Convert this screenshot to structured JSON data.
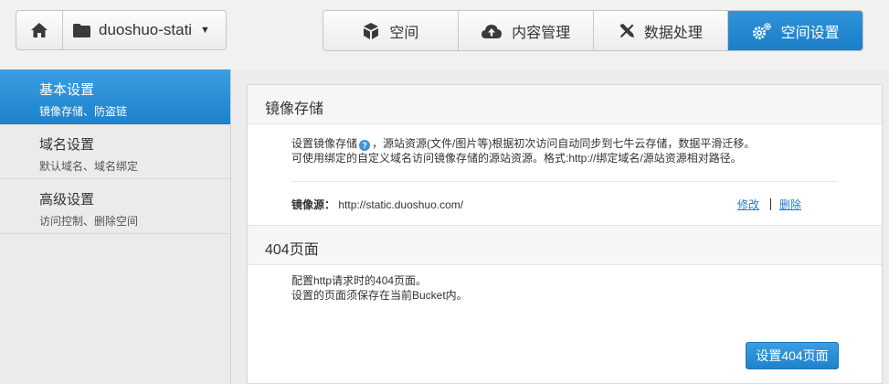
{
  "header": {
    "bucket_name": "duoshuo-static",
    "tabs": [
      {
        "label": "空间",
        "icon": "box-icon"
      },
      {
        "label": "内容管理",
        "icon": "cloud-upload-icon"
      },
      {
        "label": "数据处理",
        "icon": "tools-icon"
      },
      {
        "label": "空间设置",
        "icon": "gears-icon"
      }
    ],
    "active_tab": "空间设置"
  },
  "sidebar": {
    "items": [
      {
        "title": "基本设置",
        "sub": "镜像存储、防盗链"
      },
      {
        "title": "域名设置",
        "sub": "默认域名、域名绑定"
      },
      {
        "title": "高级设置",
        "sub": "访问控制、删除空间"
      }
    ],
    "active_item": "基本设置"
  },
  "mirror": {
    "heading": "镜像存储",
    "desc_part1": "设置镜像存储",
    "desc_part2": "，源站资源(文件/图片等)根据初次访问自动同步到七牛云存储，数据平滑迁移。",
    "desc_line2": "可使用绑定的自定义域名访问镜像存储的源站资源。格式:http://绑定域名/源站资源相对路径。",
    "source_label": "镜像源：",
    "source_value": "http://static.duoshuo.com/",
    "edit_label": "修改",
    "delete_label": "删除"
  },
  "page404": {
    "heading": "404页面",
    "desc_line1": "配置http请求时的404页面。",
    "desc_line2": "设置的页面须保存在当前Bucket内。",
    "button_label": "设置404页面"
  },
  "colors": {
    "accent": "#1e82cc",
    "link": "#2a7ac3"
  }
}
